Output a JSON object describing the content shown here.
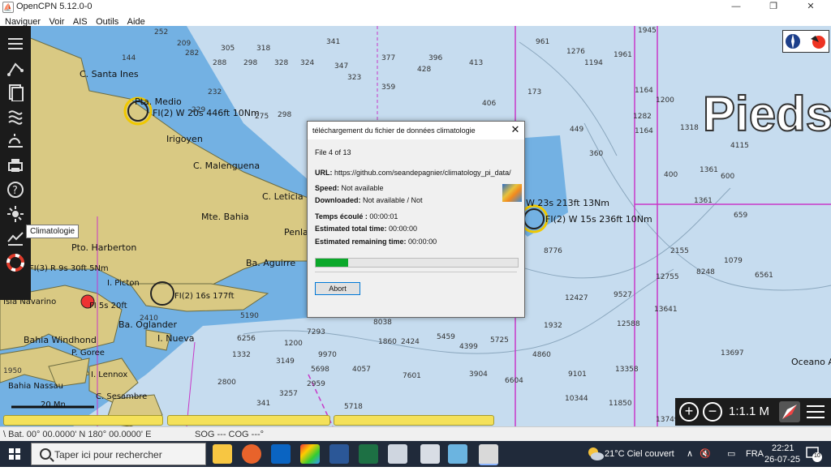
{
  "window": {
    "title": "OpenCPN 5.12.0-0"
  },
  "menu": [
    "Naviguer",
    "Voir",
    "AIS",
    "Outils",
    "Aide"
  ],
  "chart": {
    "place_labels": [
      "C. Santa Ines",
      "Pta. Medio",
      "Irigoyen",
      "C. Malenguena",
      "C. Leticia",
      "Mte. Bahia",
      "Penla",
      "Pto. Harberton",
      "Ba. Aguirre",
      "I. Picton",
      "Isla Navarino",
      "Ba. Oglander",
      "I. Nueva",
      "Bahia Windhond",
      "P. Goree",
      "I. Lennox",
      "Bahia Nassau",
      "C. Sesambre",
      "Oceano A"
    ],
    "light_labels": [
      "FI(2) W 20s 446ft 10Nm",
      "FI(3) R 9s 30ft 5Nm",
      "FI 5s 20ft",
      "FI(2) 16s 177ft",
      "FI(2) W 15s 236ft 10Nm",
      "W 23s 213ft 13Nm"
    ],
    "soundings": [
      "252",
      "305",
      "341",
      "961",
      "1276",
      "1945",
      "144",
      "282",
      "318",
      "328",
      "377",
      "396",
      "413",
      "1194",
      "1961",
      "1164",
      "1200",
      "1282",
      "209",
      "288",
      "298",
      "324",
      "347",
      "323",
      "428",
      "173",
      "1164",
      "1318",
      "232",
      "229",
      "275",
      "298",
      "406",
      "359",
      "449",
      "1361",
      "4115",
      "360",
      "400",
      "600",
      "659",
      "1361",
      "1079",
      "2155",
      "8248",
      "6561",
      "9970",
      "7293",
      "3149",
      "1860",
      "2424",
      "5459",
      "5725",
      "4860",
      "9101",
      "10344",
      "11850",
      "13749",
      "13697",
      "13358",
      "13641",
      "12755",
      "12588",
      "9527",
      "8038",
      "5698",
      "2959",
      "3257",
      "4057",
      "5718",
      "3904",
      "7601",
      "6604",
      "8776",
      "12427",
      "1932",
      "4399",
      "5190",
      "6256",
      "1332",
      "1200",
      "2800",
      "1950",
      "2410",
      "341",
      "123",
      "144"
    ],
    "scale_bar": "20 Mn",
    "units_overlay": "Pieds"
  },
  "toolbar": {
    "tooltip": "Climatologie",
    "tools": [
      "settings",
      "route",
      "tracks",
      "chart-info",
      "wave",
      "weather",
      "print",
      "help",
      "climatology",
      "tides",
      "lifebuoy"
    ]
  },
  "dialog": {
    "title": "téléchargement du fichier de données climatologie",
    "file_line": "File 4 of 13",
    "url_label": "URL:",
    "url_value": "https://github.com/seandepagnier/climatology_pi_data/",
    "speed_label": "Speed:",
    "speed_value": "Not available",
    "downloaded_label": "Downloaded:",
    "downloaded_value": "Not available / Not",
    "elapsed_label": "Temps écoulé :",
    "elapsed_value": "00:00:01",
    "total_label": "Estimated total time:",
    "total_value": "00:00:00",
    "remaining_label": "Estimated remaining time:",
    "remaining_value": "00:00:00",
    "progress": 0.16,
    "abort_label": "Abort",
    "close_glyph": "✕"
  },
  "zoom": {
    "scale": "1:1.1 M",
    "zoom_in": "+",
    "zoom_out": "−"
  },
  "status": {
    "position": "\\ Bat. 00° 00.0000' N   180° 00.0000' E",
    "sog_cog": "SOG --- COG ---°"
  },
  "taskbar": {
    "search_placeholder": "Taper ici pour rechercher",
    "weather": "21°C  Ciel couvert",
    "lang": "FRA",
    "time": "22:21",
    "date": "26-07-25",
    "notif_count": "10"
  },
  "colors": {
    "land": "#d9c983",
    "shallow": "#73b1e3",
    "deep": "#c6dcef",
    "boundary": "#c838c8",
    "progress": "#0ba82a"
  }
}
